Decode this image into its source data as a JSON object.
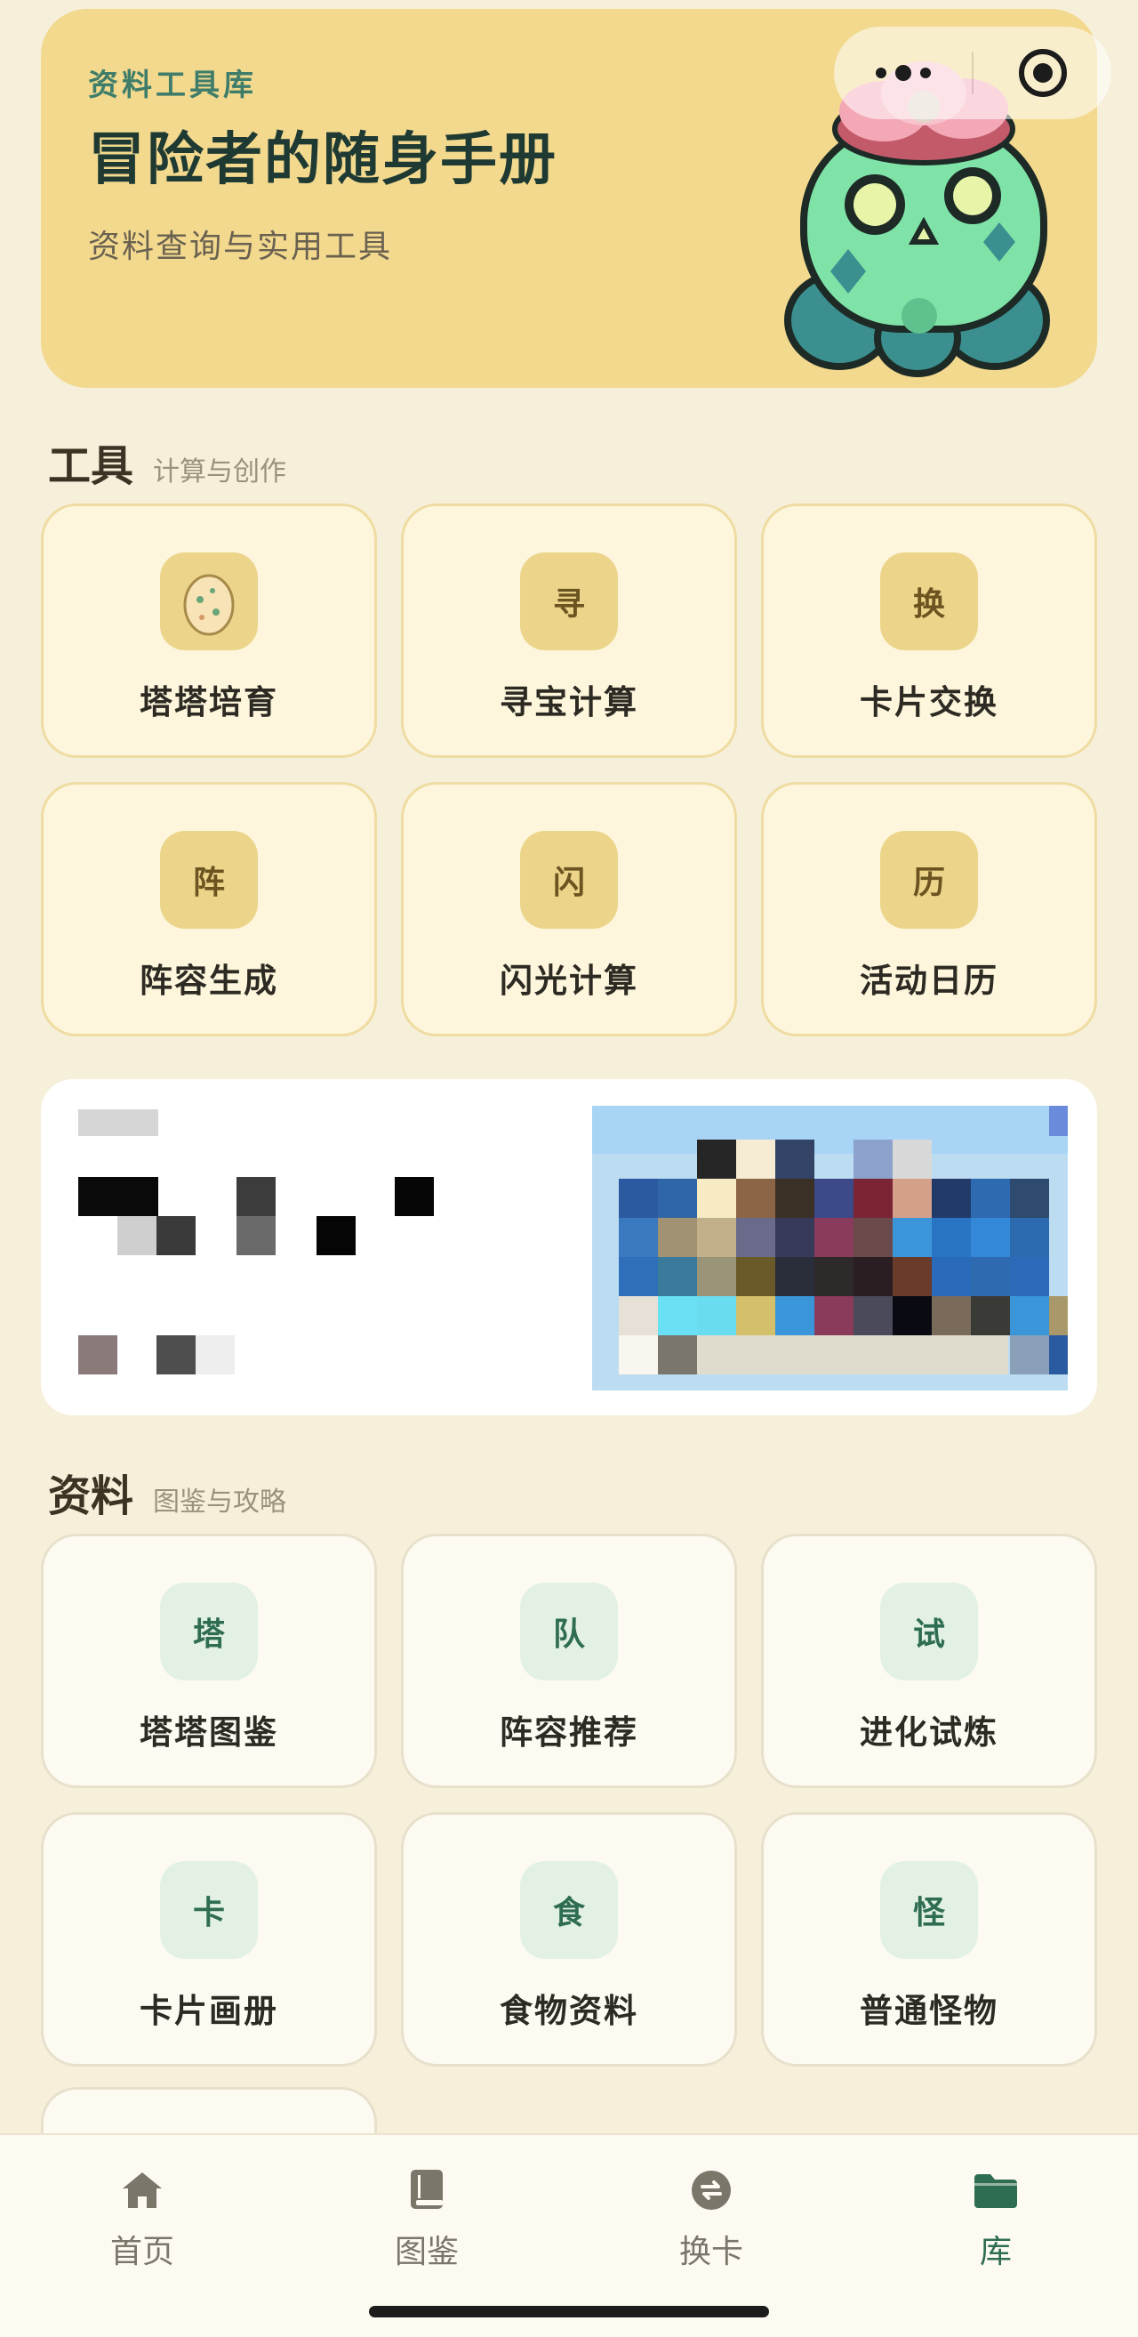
{
  "hero": {
    "eyebrow": "资料工具库",
    "title": "冒险者的随身手册",
    "subtitle": "资料查询与实用工具"
  },
  "capsule": {
    "more_icon": "more-dots-icon",
    "close_icon": "target-close-icon"
  },
  "tools_section": {
    "title": "工具",
    "subtitle": "计算与创作",
    "items": [
      {
        "badge": "",
        "label": "塔塔培育",
        "icon": "egg-icon"
      },
      {
        "badge": "寻",
        "label": "寻宝计算"
      },
      {
        "badge": "换",
        "label": "卡片交换"
      },
      {
        "badge": "阵",
        "label": "阵容生成"
      },
      {
        "badge": "闪",
        "label": "闪光计算"
      },
      {
        "badge": "历",
        "label": "活动日历"
      }
    ]
  },
  "info_section": {
    "title": "资料",
    "subtitle": "图鉴与攻略",
    "items": [
      {
        "badge": "塔",
        "label": "塔塔图鉴"
      },
      {
        "badge": "队",
        "label": "阵容推荐"
      },
      {
        "badge": "试",
        "label": "进化试炼"
      },
      {
        "badge": "卡",
        "label": "卡片画册"
      },
      {
        "badge": "食",
        "label": "食物资料"
      },
      {
        "badge": "怪",
        "label": "普通怪物"
      }
    ]
  },
  "tabbar": {
    "items": [
      {
        "label": "首页",
        "icon": "home-icon"
      },
      {
        "label": "图鉴",
        "icon": "book-icon"
      },
      {
        "label": "换卡",
        "icon": "exchange-icon"
      },
      {
        "label": "库",
        "icon": "folder-icon",
        "active": true
      }
    ]
  },
  "colors": {
    "background": "#f6efd9",
    "hero": "#f2d98e",
    "accent_green": "#2f6d52",
    "tool_badge": "#ecd58a",
    "info_badge": "#e3f1e4"
  }
}
